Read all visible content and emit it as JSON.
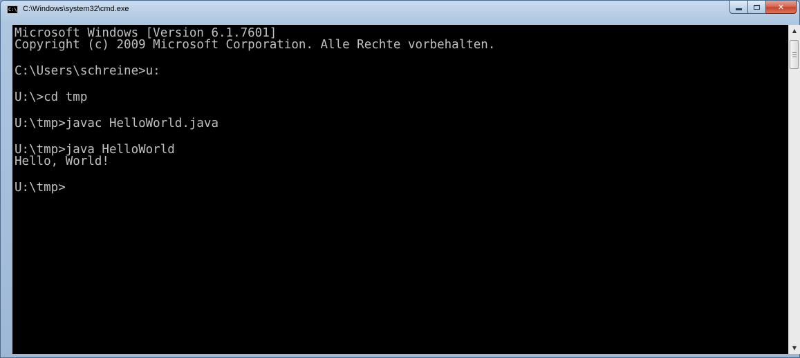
{
  "window": {
    "title": "C:\\Windows\\system32\\cmd.exe",
    "icon": "cmd-icon",
    "icon_text": "C:\\"
  },
  "controls": {
    "minimize_icon": "minimize-icon",
    "maximize_icon": "maximize-icon",
    "close_icon": "close-icon",
    "close_glyph": "✕"
  },
  "console": {
    "background": "#000000",
    "foreground": "#c0c0c0",
    "lines": [
      "Microsoft Windows [Version 6.1.7601]",
      "Copyright (c) 2009 Microsoft Corporation. Alle Rechte vorbehalten.",
      "",
      "C:\\Users\\schreine>u:",
      "",
      "U:\\>cd tmp",
      "",
      "U:\\tmp>javac HelloWorld.java",
      "",
      "U:\\tmp>java HelloWorld",
      "Hello, World!",
      "",
      "U:\\tmp>"
    ]
  },
  "scrollbar": {
    "up_glyph": "▲",
    "down_glyph": "▼"
  }
}
